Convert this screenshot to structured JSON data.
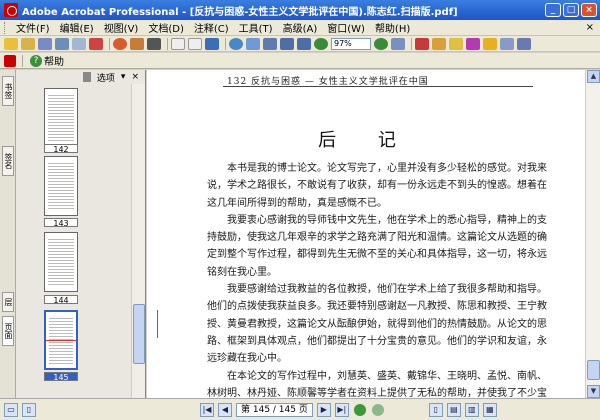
{
  "window": {
    "title": "Adobe Acrobat Professional - [反抗与困惑-女性主义文学批评在中国).陈志红.扫描版.pdf]"
  },
  "menu": [
    "文件(F)",
    "编辑(E)",
    "视图(V)",
    "文档(D)",
    "注释(C)",
    "工具(T)",
    "高级(A)",
    "窗口(W)",
    "帮助(H)"
  ],
  "menu_close": "×",
  "toolbar": {
    "zoom_value": "97%"
  },
  "toolbar2": {
    "help_label": "帮助"
  },
  "side_tabs": [
    "书签",
    "签名",
    "层",
    "页面"
  ],
  "thumbnails": {
    "options_label": "选项",
    "pages": [
      {
        "label": "142",
        "selected": false
      },
      {
        "label": "143",
        "selected": false
      },
      {
        "label": "144",
        "selected": false
      },
      {
        "label": "145",
        "selected": true
      }
    ]
  },
  "document": {
    "running_head": "132   反抗与困惑 — 女性主义文学批评在中国",
    "title": "后 记",
    "paragraphs": [
      "本书是我的博士论文。论文写完了，心里并没有多少轻松的感觉。对我来说，学术之路很长，不敢说有了收获，却有一份永远走不到头的惶惑。想着在这几年间所得到的帮助，真是感慨不已。",
      "我要衷心感谢我的导师钱中文先生，他在学术上的悉心指导，精神上的支持鼓励，使我这几年艰辛的求学之路充满了阳光和温情。这篇论文从选题的确定到整个写作过程，都得到先生无微不至的关心和具体指导，这一切，将永远铭刻在我心里。",
      "我要感谢给过我教益的各位教授，他们在学术上给了我很多帮助和指导。他们的点拨使我获益良多。我还要特别感谢赵一凡教授、陈思和教授、王宁教授、黄曼君教授，这篇论文从酝酿伊始，就得到他们的热情鼓励。从论文的思路、框架到具体观点，他们都提出了十分宝贵的意见。他们的学识和友谊，永远珍藏在我心中。",
      "在本论文的写作过程中，刘慧英、盛英、戴锦华、王晓明、孟悦、南帆、林树明、林丹娅、陈顺馨等学者在资料上提供了无私的帮助，并使我了不少宝贵意见，在此一并感谢。"
    ]
  },
  "statusbar": {
    "page_indicator": "第 145 / 145 页"
  },
  "colors": {
    "title_bar": "#1f55c8",
    "chrome": "#ece9d8",
    "selection": "#335fc9"
  }
}
